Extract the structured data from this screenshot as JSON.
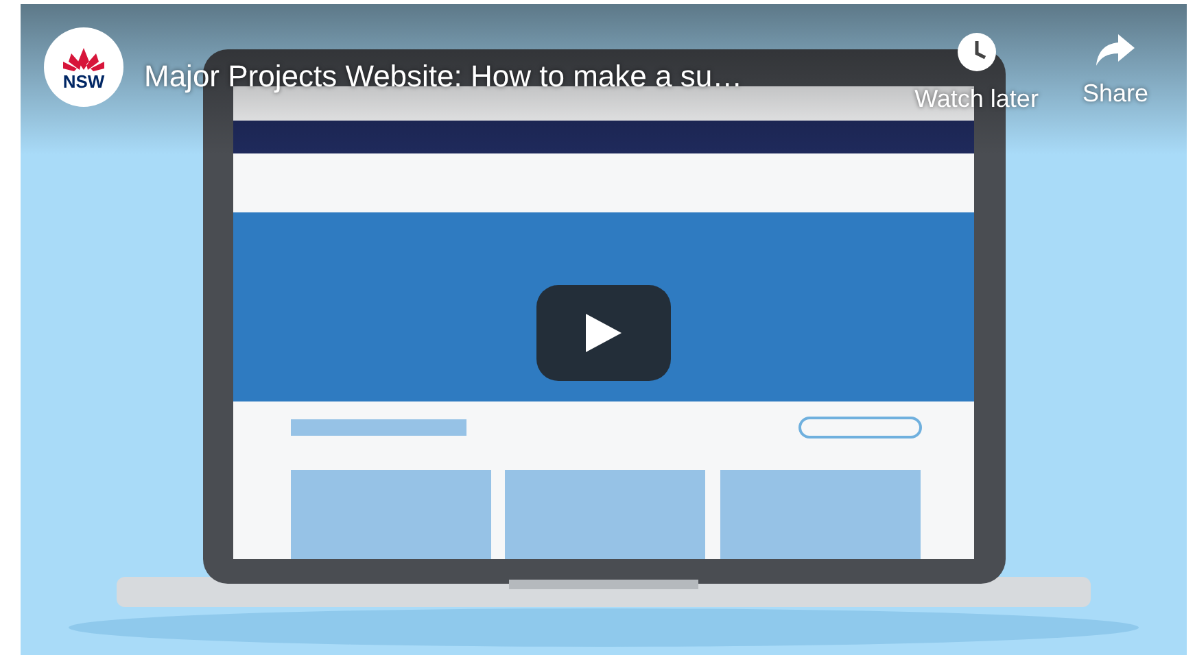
{
  "video": {
    "channel_logo": "NSW",
    "title": "Major Projects Website: How to make a su…",
    "actions": [
      {
        "label": "Watch later",
        "kind": "clock"
      },
      {
        "label": "Share",
        "kind": "share"
      }
    ]
  }
}
